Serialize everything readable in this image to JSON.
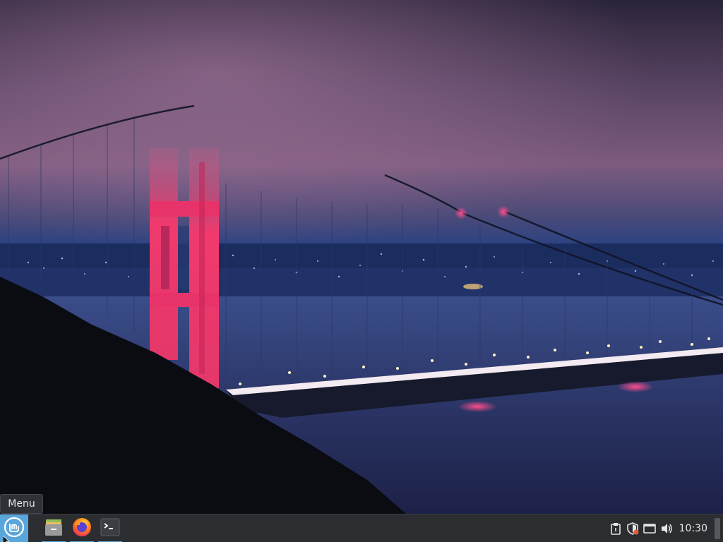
{
  "tooltip": {
    "text": "Menu"
  },
  "taskbar": {
    "menu_icon": "linux-mint-logo-icon",
    "launchers": [
      {
        "name": "files",
        "icon": "file-manager-icon"
      },
      {
        "name": "firefox",
        "icon": "firefox-icon"
      },
      {
        "name": "terminal",
        "icon": "terminal-icon"
      }
    ],
    "tray": {
      "icons": [
        "clipboard-icon",
        "update-shield-icon",
        "network-icon",
        "volume-icon"
      ],
      "clock": "10:30"
    }
  },
  "colors": {
    "accent": "#58a6dc",
    "panel_bg": "#2b2d31",
    "panel_text": "#e6e6e6"
  }
}
